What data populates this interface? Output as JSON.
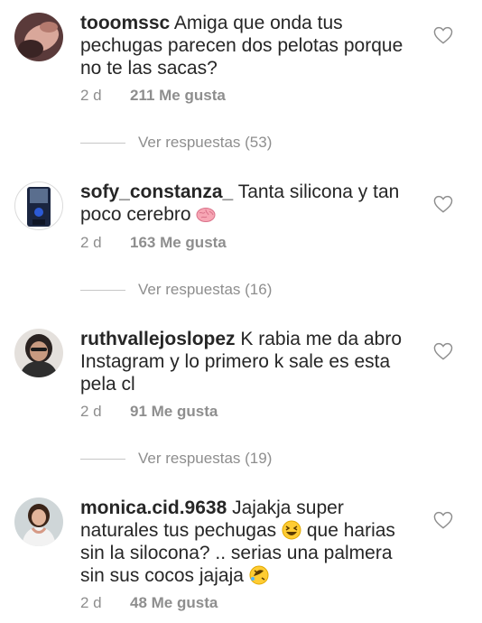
{
  "comments": [
    {
      "username": "tooomssc",
      "text": "Amiga que onda tus pechugas parecen dos pelotas porque no te las sacas?",
      "time": "2 d",
      "likes": "211 Me gusta",
      "replies_label": "Ver respuestas (53)",
      "avatar_icon": "profile-photo"
    },
    {
      "username": "sofy_constanza_",
      "text": "Tanta silicona y tan poco cerebro",
      "emoji_after": "brain-emoji",
      "time": "2 d",
      "likes": "163 Me gusta",
      "replies_label": "Ver respuestas (16)",
      "avatar_icon": "profile-photo"
    },
    {
      "username": "ruthvallejoslopez",
      "text": "K rabia me da abro Instagram y lo primero k sale es esta pela cl",
      "time": "2 d",
      "likes": "91 Me gusta",
      "replies_label": "Ver respuestas (19)",
      "avatar_icon": "profile-photo"
    },
    {
      "username": "monica.cid.9638",
      "text_part1": "Jajakja super naturales tus pechugas",
      "emoji_mid": "grinning-squinting-emoji",
      "text_part2": "que harias sin la silocona? .. serias una palmera sin sus cocos jajaja",
      "emoji_end": "rolling-laughing-emoji",
      "time": "2 d",
      "likes": "48 Me gusta",
      "avatar_icon": "profile-photo"
    }
  ],
  "colors": {
    "text": "#262626",
    "secondary": "#8e8e8e",
    "divider": "#c7c7c7"
  }
}
